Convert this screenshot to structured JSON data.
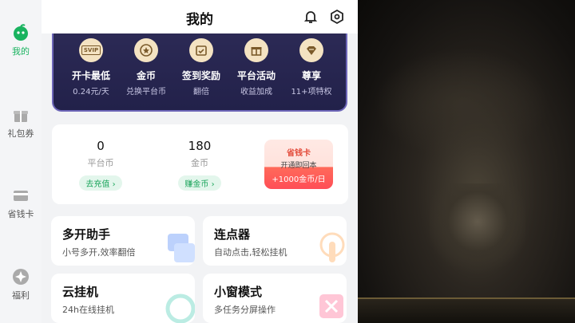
{
  "sidebar": {
    "items": [
      {
        "label": "我的",
        "icon": "avatar-icon",
        "active": true
      },
      {
        "label": "礼包券",
        "icon": "gift-icon"
      },
      {
        "label": "省钱卡",
        "icon": "card-icon"
      },
      {
        "label": "福利",
        "icon": "star-icon"
      }
    ]
  },
  "header": {
    "title": "我的",
    "icons": [
      "bell-icon",
      "settings-icon"
    ]
  },
  "vip": {
    "items": [
      {
        "title": "开卡最低",
        "subtitle": "0.24元/天",
        "icon": "svip-icon",
        "badge": "SVIP"
      },
      {
        "title": "金币",
        "subtitle": "兑换平台币",
        "icon": "coin-icon"
      },
      {
        "title": "签到奖励",
        "subtitle": "翻倍",
        "icon": "calendar-icon"
      },
      {
        "title": "平台活动",
        "subtitle": "收益加成",
        "icon": "gift-icon"
      },
      {
        "title": "尊享",
        "subtitle": "11+项特权",
        "icon": "diamond-icon"
      }
    ]
  },
  "wallet": {
    "platform_coins": {
      "value": "0",
      "label": "平台币",
      "button": "去充值 ›"
    },
    "gold_coins": {
      "value": "180",
      "label": "金币",
      "button": "赚金币 ›"
    },
    "card": {
      "title": "省钱卡",
      "subtitle": "开通即回本",
      "bottom": "+1000金币/日"
    }
  },
  "tools": [
    {
      "title": "多开助手",
      "subtitle": "小号多开,效率翻倍"
    },
    {
      "title": "连点器",
      "subtitle": "自动点击,轻松挂机"
    },
    {
      "title": "云挂机",
      "subtitle": "24h在线挂机"
    },
    {
      "title": "小窗模式",
      "subtitle": "多任务分屏操作"
    }
  ],
  "colors": {
    "accent": "#19b35f",
    "vip_bg": "#23224c",
    "card_red": "#ff4e56"
  }
}
